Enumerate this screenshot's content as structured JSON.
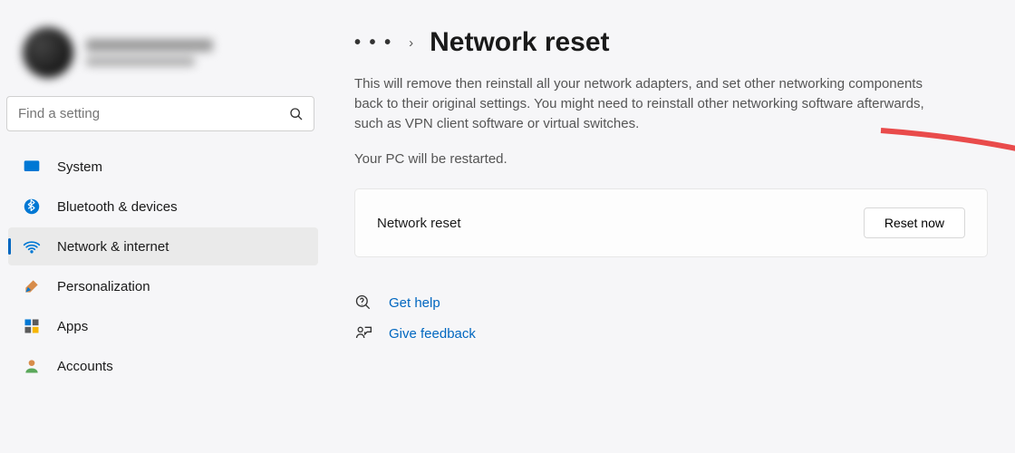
{
  "profile": {
    "name_placeholder": "",
    "email_placeholder": ""
  },
  "search": {
    "placeholder": "Find a setting"
  },
  "sidebar": {
    "items": [
      {
        "label": "System",
        "icon": "system-icon",
        "active": false
      },
      {
        "label": "Bluetooth & devices",
        "icon": "bluetooth-icon",
        "active": false
      },
      {
        "label": "Network & internet",
        "icon": "wifi-icon",
        "active": true
      },
      {
        "label": "Personalization",
        "icon": "brush-icon",
        "active": false
      },
      {
        "label": "Apps",
        "icon": "apps-icon",
        "active": false
      },
      {
        "label": "Accounts",
        "icon": "person-icon",
        "active": false
      }
    ]
  },
  "breadcrumb": {
    "ellipsis": "• • •",
    "chevron": "›",
    "title": "Network reset"
  },
  "description": "This will remove then reinstall all your network adapters, and set other networking components back to their original settings. You might need to reinstall other networking software afterwards, such as VPN client software or virtual switches.",
  "sub_description": "Your PC will be restarted.",
  "card": {
    "label": "Network reset",
    "button": "Reset now"
  },
  "help": {
    "get_help": "Get help",
    "give_feedback": "Give feedback"
  }
}
